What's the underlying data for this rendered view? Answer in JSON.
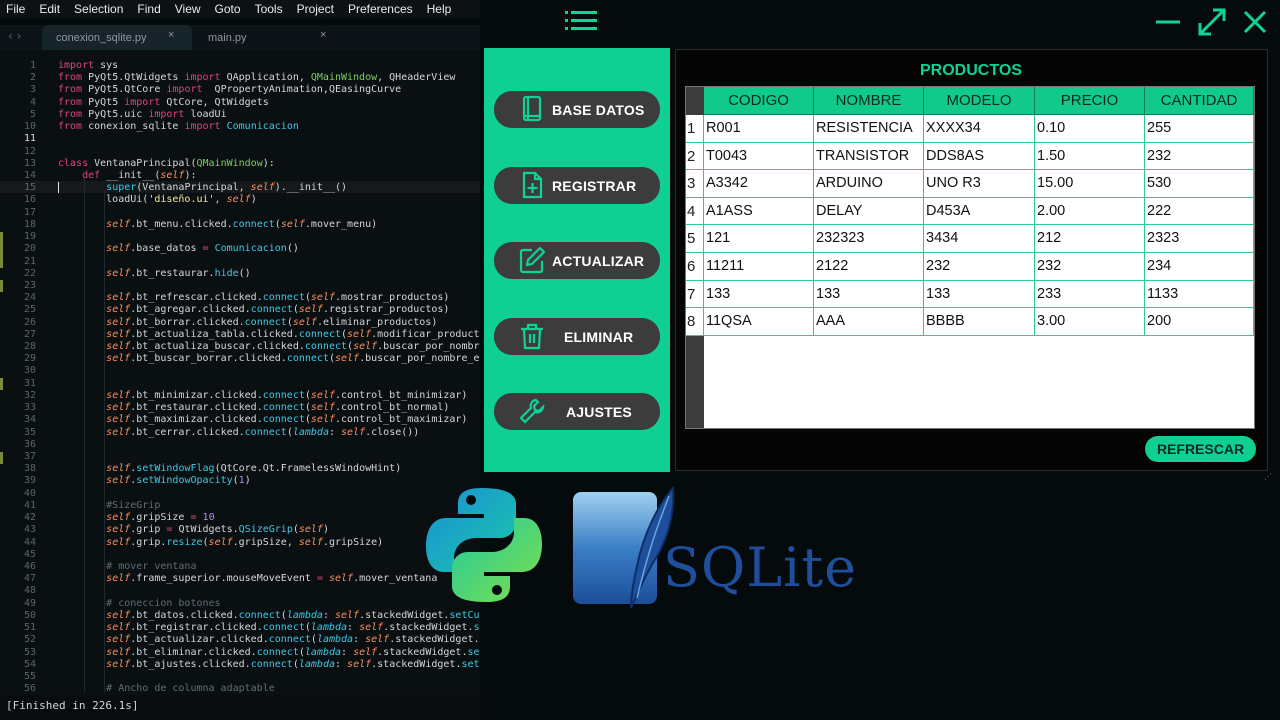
{
  "menubar": [
    "File",
    "Edit",
    "Selection",
    "Find",
    "View",
    "Goto",
    "Tools",
    "Project",
    "Preferences",
    "Help"
  ],
  "tabs": [
    {
      "label": "conexion_sqlite.py",
      "close": "×"
    },
    {
      "label": "main.py",
      "close": "×"
    }
  ],
  "nav_arrows": "‹ ›",
  "editor": {
    "current_line": 11,
    "lines": [
      {
        "n": 1,
        "t": "import sys"
      },
      {
        "n": 2,
        "t": "from PyQt5.QtWidgets import QApplication, QMainWindow, QHeaderView"
      },
      {
        "n": 3,
        "t": "from PyQt5.QtCore import  QPropertyAnimation,QEasingCurve"
      },
      {
        "n": 4,
        "t": "from PyQt5 import QtCore, QtWidgets"
      },
      {
        "n": 5,
        "t": "from PyQt5.uic import loadUi"
      },
      {
        "n": 10,
        "t": "from conexion_sqlite import Comunicacion"
      },
      {
        "n": 11,
        "t": ""
      },
      {
        "n": 12,
        "t": ""
      },
      {
        "n": 13,
        "t": "class VentanaPrincipal(QMainWindow):"
      },
      {
        "n": 14,
        "t": "    def __init__(self):"
      },
      {
        "n": 15,
        "t": "        super(VentanaPrincipal, self).__init__()"
      },
      {
        "n": 16,
        "t": "        loadUi('diseño.ui', self)"
      },
      {
        "n": 17,
        "t": ""
      },
      {
        "n": 18,
        "t": "        self.bt_menu.clicked.connect(self.mover_menu)"
      },
      {
        "n": 19,
        "t": ""
      },
      {
        "n": 20,
        "t": "        self.base_datos = Comunicacion()"
      },
      {
        "n": 21,
        "t": ""
      },
      {
        "n": 22,
        "t": "        self.bt_restaurar.hide()"
      },
      {
        "n": 23,
        "t": ""
      },
      {
        "n": 24,
        "t": "        self.bt_refrescar.clicked.connect(self.mostrar_productos)"
      },
      {
        "n": 25,
        "t": "        self.bt_agregar.clicked.connect(self.registrar_productos)"
      },
      {
        "n": 26,
        "t": "        self.bt_borrar.clicked.connect(self.eliminar_productos)"
      },
      {
        "n": 27,
        "t": "        self.bt_actualiza_tabla.clicked.connect(self.modificar_productos)"
      },
      {
        "n": 28,
        "t": "        self.bt_actualiza_buscar.clicked.connect(self.buscar_por_nombre_ac"
      },
      {
        "n": 29,
        "t": "        self.bt_buscar_borrar.clicked.connect(self.buscar_por_nombre_elimi"
      },
      {
        "n": 30,
        "t": ""
      },
      {
        "n": 31,
        "t": ""
      },
      {
        "n": 32,
        "t": "        self.bt_minimizar.clicked.connect(self.control_bt_minimizar)"
      },
      {
        "n": 33,
        "t": "        self.bt_restaurar.clicked.connect(self.control_bt_normal)"
      },
      {
        "n": 34,
        "t": "        self.bt_maximizar.clicked.connect(self.control_bt_maximizar)"
      },
      {
        "n": 35,
        "t": "        self.bt_cerrar.clicked.connect(lambda: self.close())"
      },
      {
        "n": 36,
        "t": ""
      },
      {
        "n": 37,
        "t": ""
      },
      {
        "n": 38,
        "t": "        self.setWindowFlag(QtCore.Qt.FramelessWindowHint)"
      },
      {
        "n": 39,
        "t": "        self.setWindowOpacity(1)"
      },
      {
        "n": 40,
        "t": ""
      },
      {
        "n": 41,
        "t": "        #SizeGrip"
      },
      {
        "n": 42,
        "t": "        self.gripSize = 10"
      },
      {
        "n": 43,
        "t": "        self.grip = QtWidgets.QSizeGrip(self)"
      },
      {
        "n": 44,
        "t": "        self.grip.resize(self.gripSize, self.gripSize)"
      },
      {
        "n": 45,
        "t": ""
      },
      {
        "n": 46,
        "t": "        # mover ventana"
      },
      {
        "n": 47,
        "t": "        self.frame_superior.mouseMoveEvent = self.mover_ventana"
      },
      {
        "n": 48,
        "t": ""
      },
      {
        "n": 49,
        "t": "        # coneccion botones"
      },
      {
        "n": 50,
        "t": "        self.bt_datos.clicked.connect(lambda: self.stackedWidget.setCurrentWidget(self.page_datos))"
      },
      {
        "n": 51,
        "t": "        self.bt_registrar.clicked.connect(lambda: self.stackedWidget.setCurrentWidget(self.page_registrar))"
      },
      {
        "n": 52,
        "t": "        self.bt_actualizar.clicked.connect(lambda: self.stackedWidget.setCurrentWidget(self.page_actualizar))"
      },
      {
        "n": 53,
        "t": "        self.bt_eliminar.clicked.connect(lambda: self.stackedWidget.setCurrentWidget(self.page_eliminar))"
      },
      {
        "n": 54,
        "t": "        self.bt_ajustes.clicked.connect(lambda: self.stackedWidget.setCurrentWidget(self.page_ajustes))"
      },
      {
        "n": 55,
        "t": ""
      },
      {
        "n": 56,
        "t": "        # Ancho de columna adaptable"
      }
    ]
  },
  "status": {
    "text": "[Finished in 226.1s]"
  },
  "app": {
    "sidebar": [
      {
        "label": "BASE DATOS",
        "icon": "book-icon"
      },
      {
        "label": "REGISTRAR",
        "icon": "file-plus-icon"
      },
      {
        "label": "ACTUALIZAR",
        "icon": "edit-icon"
      },
      {
        "label": "ELIMINAR",
        "icon": "trash-icon"
      },
      {
        "label": "AJUSTES",
        "icon": "wrench-icon"
      }
    ],
    "title": "PRODUCTOS",
    "columns": [
      "CODIGO",
      "NOMBRE",
      "MODELO",
      "PRECIO",
      "CANTIDAD"
    ],
    "rows": [
      [
        "R001",
        "RESISTENCIA",
        "XXXX34",
        "0.10",
        "255"
      ],
      [
        "T0043",
        "TRANSISTOR",
        "DDS8AS",
        "1.50",
        "232"
      ],
      [
        "A3342",
        "ARDUINO",
        "UNO R3",
        "15.00",
        "530"
      ],
      [
        "A1ASS",
        "DELAY",
        "D453A",
        "2.00",
        "222"
      ],
      [
        "121",
        "232323",
        "3434",
        "212",
        "2323"
      ],
      [
        "11211",
        "2122",
        "232",
        "232",
        "234"
      ],
      [
        "133",
        "133",
        "133",
        "233",
        "1133"
      ],
      [
        "11QSA",
        "AAA",
        "BBBB",
        "3.00",
        "200"
      ]
    ],
    "refresh_label": "REFRESCAR",
    "accent_color": "#0fcf93",
    "window_controls": [
      "minimize-icon",
      "maximize-icon",
      "close-icon"
    ]
  },
  "logos": {
    "python": "python-logo",
    "sqlite": "SQLite"
  }
}
